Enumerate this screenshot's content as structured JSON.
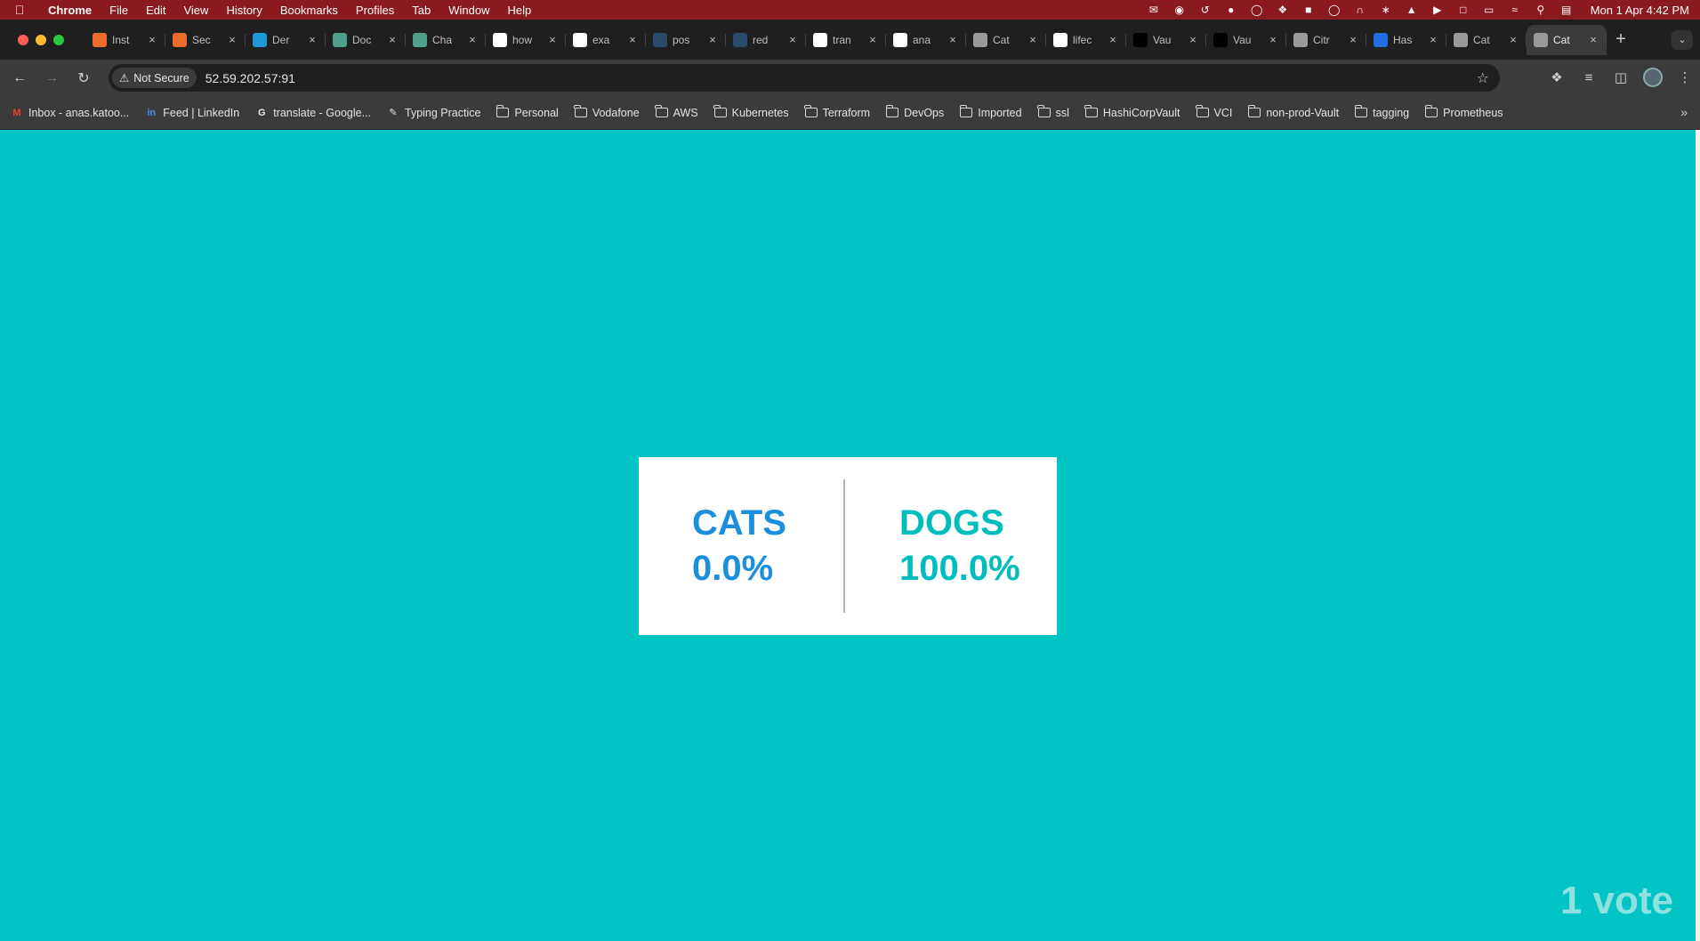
{
  "menubar": {
    "app": "Chrome",
    "items": [
      "File",
      "Edit",
      "View",
      "History",
      "Bookmarks",
      "Profiles",
      "Tab",
      "Window",
      "Help"
    ],
    "clock": "Mon 1 Apr  4:42 PM"
  },
  "tabs": [
    {
      "title": "Inst",
      "color": "#e96c2c"
    },
    {
      "title": "Sec",
      "color": "#e96c2c"
    },
    {
      "title": "Der",
      "color": "#1e9ad6"
    },
    {
      "title": "Doc",
      "color": "#4ea08a"
    },
    {
      "title": "Cha",
      "color": "#4ea08a"
    },
    {
      "title": "how",
      "color": "#ffffff"
    },
    {
      "title": "exa",
      "color": "#ffffff"
    },
    {
      "title": "pos",
      "color": "#2a4a6a"
    },
    {
      "title": "red",
      "color": "#2a4a6a"
    },
    {
      "title": "tran",
      "color": "#ffffff"
    },
    {
      "title": "ana",
      "color": "#ffffff"
    },
    {
      "title": "Cat",
      "color": "#9a9a9a"
    },
    {
      "title": "lifec",
      "color": "#ffffff"
    },
    {
      "title": "Vau",
      "color": "#000000"
    },
    {
      "title": "Vau",
      "color": "#000000"
    },
    {
      "title": "Citr",
      "color": "#9a9a9a"
    },
    {
      "title": "Has",
      "color": "#1f6fe0"
    },
    {
      "title": "Cat",
      "color": "#9a9a9a"
    },
    {
      "title": "Cat",
      "color": "#9a9a9a",
      "active": true
    }
  ],
  "toolbar": {
    "security_label": "Not Secure",
    "url": "52.59.202.57:91"
  },
  "bookmarks": [
    {
      "label": "Inbox - anas.katoo...",
      "icon": "gmail-icon"
    },
    {
      "label": "Feed | LinkedIn",
      "icon": "linkedin-icon"
    },
    {
      "label": "translate - Google...",
      "icon": "google-icon"
    },
    {
      "label": "Typing Practice",
      "icon": "typing-icon"
    },
    {
      "label": "Personal",
      "icon": "folder-icon"
    },
    {
      "label": "Vodafone",
      "icon": "folder-icon"
    },
    {
      "label": "AWS",
      "icon": "folder-icon"
    },
    {
      "label": "Kubernetes",
      "icon": "folder-icon"
    },
    {
      "label": "Terraform",
      "icon": "folder-icon"
    },
    {
      "label": "DevOps",
      "icon": "folder-icon"
    },
    {
      "label": "Imported",
      "icon": "folder-icon"
    },
    {
      "label": "ssl",
      "icon": "folder-icon"
    },
    {
      "label": "HashiCorpVault",
      "icon": "folder-icon"
    },
    {
      "label": "VCI",
      "icon": "folder-icon"
    },
    {
      "label": "non-prod-Vault",
      "icon": "folder-icon"
    },
    {
      "label": "tagging",
      "icon": "folder-icon"
    },
    {
      "label": "Prometheus",
      "icon": "folder-icon"
    }
  ],
  "page": {
    "background": "#00c4c4",
    "option_a": {
      "label": "CATS",
      "percent": "0.0%",
      "color": "#1a8fde"
    },
    "option_b": {
      "label": "DOGS",
      "percent": "100.0%",
      "color": "#00bdbd"
    },
    "votes": "1 vote"
  }
}
